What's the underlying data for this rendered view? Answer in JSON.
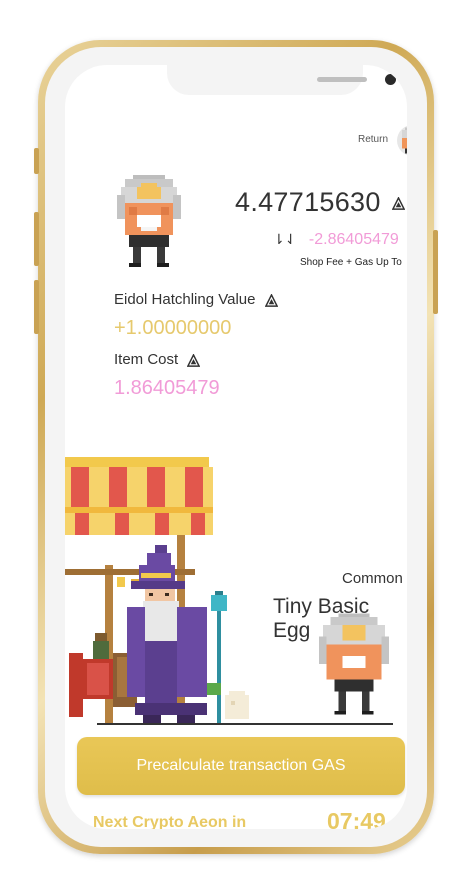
{
  "header": {
    "return_label": "Return",
    "balance": "4.47715630",
    "delta_arrow": "⇂⇃",
    "delta": "-2.86405479",
    "fee_note": "Shop Fee + Gas Up To"
  },
  "values": {
    "hatchling_label": "Eidol Hatchling Value",
    "hatchling_value": "+1.00000000",
    "cost_label": "Item Cost",
    "cost_value": "1.86405479"
  },
  "item": {
    "rarity": "Common",
    "name": "Tiny Basic Egg"
  },
  "footer": {
    "button_label": "Precalculate transaction GAS",
    "aeon_label": "Next Crypto Aeon in",
    "timer": "07:49"
  },
  "colors": {
    "gold": "#e6c96d",
    "pink": "#f19bd7",
    "button": "#e2c050"
  },
  "icons": [
    "gas-triangle-icon",
    "avatar-egg-icon",
    "wizard-shop-illustration"
  ]
}
